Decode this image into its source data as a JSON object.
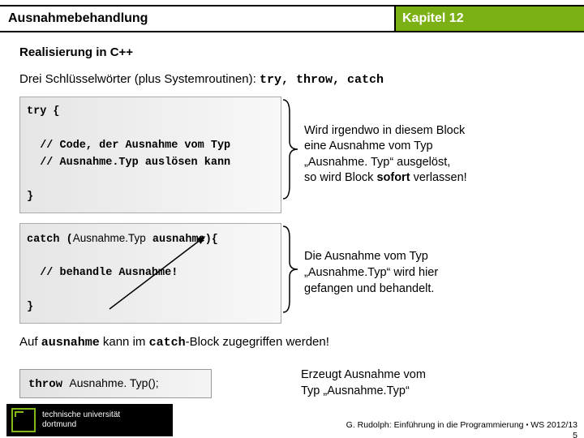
{
  "header": {
    "title": "Ausnahmebehandlung",
    "chapter": "Kapitel 12"
  },
  "subtitle": "Realisierung in C++",
  "intro_prefix": "Drei Schlüsselwörter (plus Systemroutinen):  ",
  "intro_code": "try, throw, catch",
  "code_block_1": "try {\n\n  // Code, der Ausnahme vom Typ\n  // Ausnahme.Typ auslösen kann\n\n}",
  "caption_1_l1": "Wird irgendwo in diesem Block",
  "caption_1_l2": "eine Ausnahme vom Typ",
  "caption_1_l3": "„Ausnahme. Typ“ ausgelöst,",
  "caption_1_l4a": "so wird Block ",
  "caption_1_l4b": "sofort",
  "caption_1_l4c": " verlassen!",
  "code_block_2_a": "catch ",
  "code_block_2_b": "(",
  "code_block_2_type": "Ausnahme.Typ",
  "code_block_2_c": " ausnahme){\n\n  // behandle Ausnahme!\n\n}",
  "caption_2_l1": "Die Ausnahme vom Typ",
  "caption_2_l2": "„Ausnahme.Typ“ wird hier",
  "caption_2_l3": "gefangen und behandelt.",
  "afternote_a": "Auf ",
  "afternote_b": "ausnahme",
  "afternote_c": " kann im ",
  "afternote_d": "catch",
  "afternote_e": "-Block zugegriffen werden!",
  "throw_code_a": "throw ",
  "throw_code_b": "Ausnahme. Typ",
  "throw_code_c": "();",
  "throw_cap_l1": "Erzeugt Ausnahme vom",
  "throw_cap_l2": "Typ „Ausnahme.Typ“",
  "logo": {
    "line1": "technische universität",
    "line2": "dortmund"
  },
  "footer": {
    "line1a": "G. Rudolph: Einführung in die Programmierung ",
    "line1b": "▪",
    "line1c": " WS 2012/13",
    "line2": "5"
  }
}
